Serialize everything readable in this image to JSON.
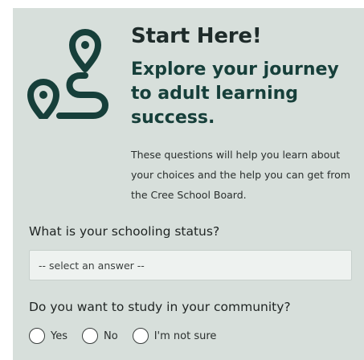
{
  "header": {
    "title": "Start Here!",
    "subtitle": "Explore your journey to adult learning success.",
    "intro": "These questions will help you learn about your choices and the help you can get from the Cree School Board.",
    "icon": "map-route-pins-icon"
  },
  "questions": {
    "schooling": {
      "label": "What is your schooling status?",
      "select_value": "-- select an answer --"
    },
    "community": {
      "label": "Do you want to study in your community?",
      "options": [
        "Yes",
        "No",
        "I'm not sure"
      ]
    }
  },
  "colors": {
    "background": "#d7dfdb",
    "accent": "#163f3a",
    "select_bg": "#eef2f0"
  }
}
